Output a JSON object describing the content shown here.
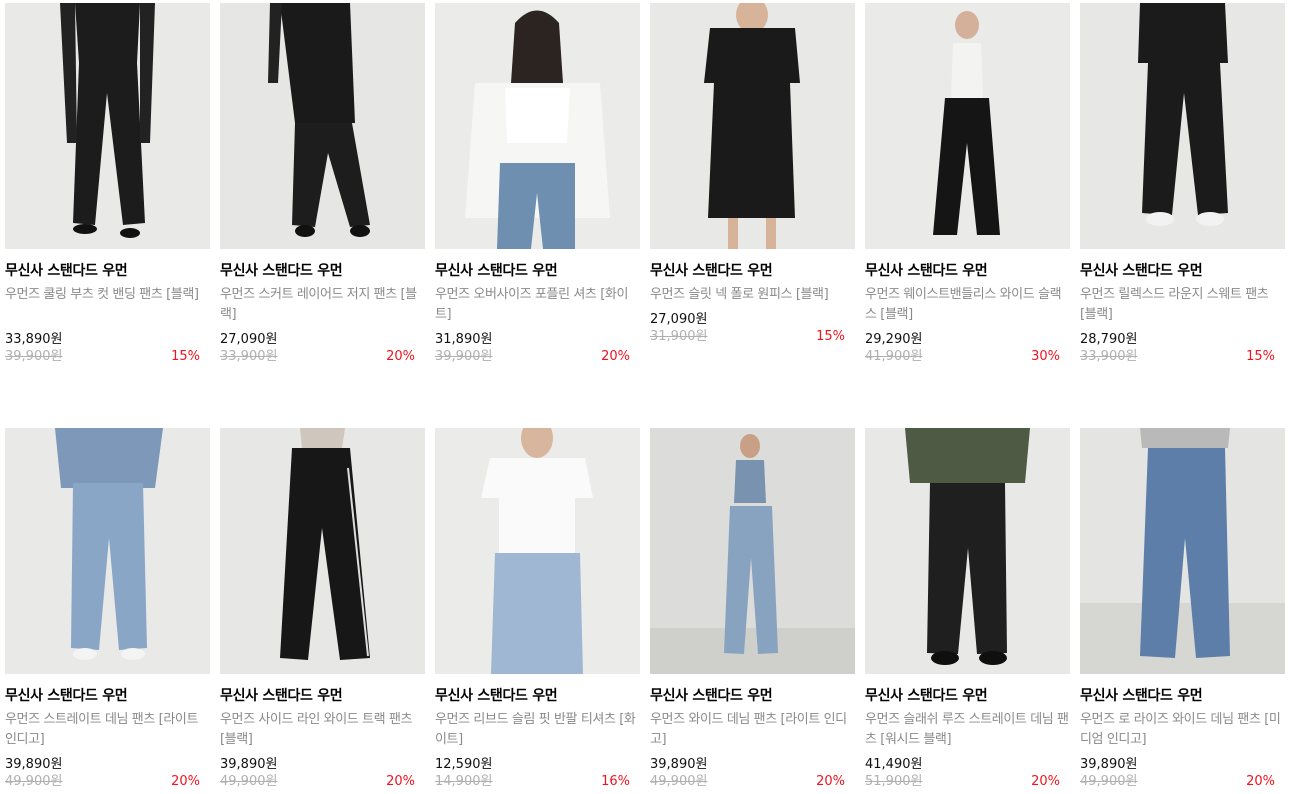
{
  "colors": {
    "discount": "#f0141e",
    "original_price": "#b0b0b0",
    "product_name": "#8a8a8a"
  },
  "products": [
    {
      "brand": "무신사 스탠다드 우먼",
      "name": "우먼즈 쿨링 부츠 컷 밴딩 팬츠 [블랙]",
      "price": "33,890원",
      "original_price": "39,900원",
      "discount": "15%",
      "image": "black-flare-pants-photo"
    },
    {
      "brand": "무신사 스탠다드 우먼",
      "name": "우먼즈 스커트 레이어드 저지 팬츠 [블랙]",
      "price": "27,090원",
      "original_price": "33,900원",
      "discount": "20%",
      "image": "skirt-layered-pants-photo"
    },
    {
      "brand": "무신사 스탠다드 우먼",
      "name": "우먼즈 오버사이즈 포플린 셔츠 [화이트]",
      "price": "31,890원",
      "original_price": "39,900원",
      "discount": "20%",
      "image": "white-poplin-shirt-photo"
    },
    {
      "brand": "무신사 스탠다드 우먼",
      "name": "우먼즈 슬릿 넥 폴로 원피스 [블랙]",
      "price": "27,090원",
      "original_price": "31,900원",
      "discount": "15%",
      "image": "black-polo-dress-photo"
    },
    {
      "brand": "무신사 스탠다드 우먼",
      "name": "우먼즈 웨이스트밴들리스 와이드 슬랙스 [블랙]",
      "price": "29,290원",
      "original_price": "41,900원",
      "discount": "30%",
      "image": "black-wide-slacks-photo"
    },
    {
      "brand": "무신사 스탠다드 우먼",
      "name": "우먼즈 릴렉스드 라운지 스웨트 팬츠 [블랙]",
      "price": "28,790원",
      "original_price": "33,900원",
      "discount": "15%",
      "image": "black-sweat-pants-photo"
    },
    {
      "brand": "무신사 스탠다드 우먼",
      "name": "우먼즈 스트레이트 데님 팬츠 [라이트 인디고]",
      "price": "39,890원",
      "original_price": "49,900원",
      "discount": "20%",
      "image": "light-denim-straight-photo"
    },
    {
      "brand": "무신사 스탠다드 우먼",
      "name": "우먼즈 사이드 라인 와이드 트랙 팬츠 [블랙]",
      "price": "39,890원",
      "original_price": "49,900원",
      "discount": "20%",
      "image": "black-track-pants-photo"
    },
    {
      "brand": "무신사 스탠다드 우먼",
      "name": "우먼즈 리브드 슬림 핏 반팔 티셔츠 [화이트]",
      "price": "12,590원",
      "original_price": "14,900원",
      "discount": "16%",
      "image": "white-ribbed-tee-photo"
    },
    {
      "brand": "무신사 스탠다드 우먼",
      "name": "우먼즈 와이드 데님 팬츠 [라이트 인디고]",
      "price": "39,890원",
      "original_price": "49,900원",
      "discount": "20%",
      "image": "light-wide-denim-photo"
    },
    {
      "brand": "무신사 스탠다드 우먼",
      "name": "우먼즈 슬래쉬 루즈 스트레이트 데님 팬츠 [워시드 블랙]",
      "price": "41,490원",
      "original_price": "51,900원",
      "discount": "20%",
      "image": "washed-black-denim-photo"
    },
    {
      "brand": "무신사 스탠다드 우먼",
      "name": "우먼즈 로 라이즈 와이드 데님 팬츠 [미디엄 인디고]",
      "price": "39,890원",
      "original_price": "49,900원",
      "discount": "20%",
      "image": "medium-indigo-denim-photo"
    }
  ]
}
